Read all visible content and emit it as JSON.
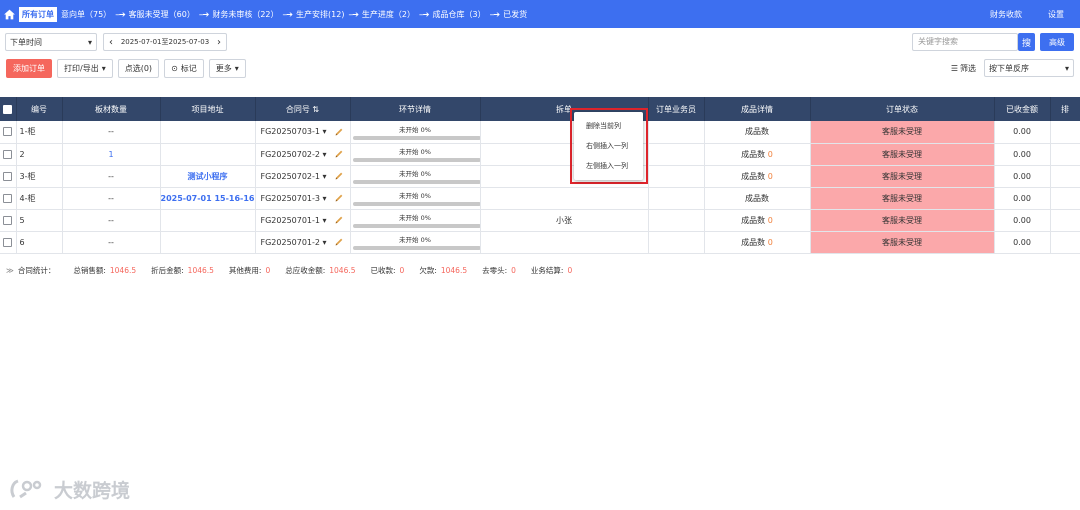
{
  "nav": {
    "active": "所有订单",
    "steps": [
      {
        "label": "意向单（75）"
      },
      {
        "label": "客服未受理（60）"
      },
      {
        "label": "财务未审核（22）"
      },
      {
        "label": "生产安排(12)"
      },
      {
        "label": "生产进度（2）"
      },
      {
        "label": "成品仓库（3）"
      },
      {
        "label": "已发货"
      }
    ],
    "arrow": "--➔",
    "finance": "财务收款",
    "settings": "设置"
  },
  "filters": {
    "time_select": "下单时间",
    "date_range": "2025-07-01至2025-07-03",
    "search_placeholder": "关键字搜索",
    "search_btn": "搜",
    "advanced": "高级"
  },
  "actions": {
    "add_order": "添加订单",
    "print_export": "打印/导出",
    "selected": "点选(0)",
    "mark": "标记",
    "more": "更多",
    "filter": "筛选",
    "sort": "按下单反序"
  },
  "table": {
    "headers": [
      "编号",
      "板材数量",
      "项目地址",
      "合同号",
      "环节详情",
      "拆单",
      "订单业务员",
      "成品详情",
      "订单状态",
      "已收金额",
      "排"
    ],
    "rows": [
      {
        "id": "1-柜",
        "qty": "--",
        "addr": "",
        "contract": "FG20250703-1",
        "progress": "未开始 0%",
        "split": "",
        "sales": "",
        "product": "成品数",
        "product_num": "",
        "status": "客服未受理",
        "amount": "0.00"
      },
      {
        "id": "2",
        "qty": "1",
        "addr": "",
        "contract": "FG20250702-2",
        "progress": "未开始 0%",
        "split": "",
        "sales": "",
        "product": "成品数",
        "product_num": "0",
        "status": "客服未受理",
        "amount": "0.00"
      },
      {
        "id": "3-柜",
        "qty": "--",
        "addr": "测试小程序",
        "contract": "FG20250702-1",
        "progress": "未开始 0%",
        "split": "",
        "sales": "",
        "product": "成品数",
        "product_num": "0",
        "status": "客服未受理",
        "amount": "0.00"
      },
      {
        "id": "4-柜",
        "qty": "--",
        "addr": "2025-07-01 15-16-16",
        "contract": "FG20250701-3",
        "progress": "未开始 0%",
        "split": "",
        "sales": "",
        "product": "成品数",
        "product_num": "",
        "status": "客服未受理",
        "amount": "0.00"
      },
      {
        "id": "5",
        "qty": "--",
        "addr": "",
        "contract": "FG20250701-1",
        "progress": "未开始 0%",
        "split": "小张",
        "sales": "",
        "product": "成品数",
        "product_num": "0",
        "status": "客服未受理",
        "amount": "0.00"
      },
      {
        "id": "6",
        "qty": "--",
        "addr": "",
        "contract": "FG20250701-2",
        "progress": "未开始 0%",
        "split": "",
        "sales": "",
        "product": "成品数",
        "product_num": "0",
        "status": "客服未受理",
        "amount": "0.00"
      }
    ]
  },
  "context_menu": {
    "items": [
      "删除当前列",
      "右侧插入一列",
      "左侧插入一列"
    ]
  },
  "summary": {
    "title": "合同统计：",
    "items": [
      {
        "label": "总销售额:",
        "value": "1046.5"
      },
      {
        "label": "折后金额:",
        "value": "1046.5"
      },
      {
        "label": "其他费用:",
        "value": "0"
      },
      {
        "label": "总应收金额:",
        "value": "1046.5"
      },
      {
        "label": "已收款:",
        "value": "0"
      },
      {
        "label": "欠款:",
        "value": "1046.5"
      },
      {
        "label": "去零头:",
        "value": "0"
      },
      {
        "label": "业务结算:",
        "value": "0"
      }
    ]
  },
  "watermark": "大数跨境",
  "colors": {
    "primary": "#3d6ff0",
    "header_bg": "#33476a",
    "status_bg": "#fba8aa",
    "add_btn": "#f5675d",
    "highlight": "#e0252c"
  }
}
